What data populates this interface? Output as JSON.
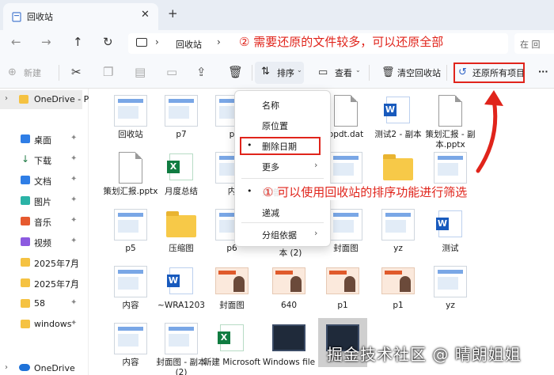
{
  "window": {
    "tab_title": "回收站",
    "close_glyph": "✕",
    "new_tab_glyph": "+"
  },
  "nav": {
    "back_glyph": "←",
    "forward_glyph": "→",
    "up_glyph": "↑",
    "refresh_glyph": "↻",
    "chevron": "›"
  },
  "address": {
    "location": "回收站",
    "search_placeholder": "在 回"
  },
  "toolbar": {
    "new_label": "新建",
    "sort_label": "排序",
    "view_label": "查看",
    "empty_bin_label": "清空回收站",
    "restore_all_label": "还原所有项目",
    "more_glyph": "···"
  },
  "sidebar": {
    "onedrive_top": "OneDrive - P",
    "items": [
      {
        "label": "桌面",
        "icon": "desktop-icon",
        "pinned": true
      },
      {
        "label": "下载",
        "icon": "download-icon",
        "pinned": true
      },
      {
        "label": "文档",
        "icon": "documents-icon",
        "pinned": true
      },
      {
        "label": "图片",
        "icon": "pictures-icon",
        "pinned": true
      },
      {
        "label": "音乐",
        "icon": "music-icon",
        "pinned": true
      },
      {
        "label": "视频",
        "icon": "videos-icon",
        "pinned": true
      },
      {
        "label": "2025年7月",
        "icon": "folder-icon",
        "pinned": true
      },
      {
        "label": "2025年7月",
        "icon": "folder-icon",
        "pinned": true
      },
      {
        "label": "58",
        "icon": "folder-icon",
        "pinned": true
      },
      {
        "label": "windows",
        "icon": "folder-icon",
        "pinned": true
      }
    ],
    "onedrive_bottom": "OneDrive",
    "pin_glyph": "📌"
  },
  "files": [
    {
      "name": "回收站",
      "kind": "thumb"
    },
    {
      "name": "p7",
      "kind": "thumb"
    },
    {
      "name": "opdt.dat",
      "kind": "doc"
    },
    {
      "name": "测试2 - 副本",
      "kind": "word"
    },
    {
      "name": "策划汇报 - 副本.pptx",
      "kind": "doc"
    },
    {
      "name": "策划汇报.pptx",
      "kind": "doc"
    },
    {
      "name": "月度总结",
      "kind": "excel"
    },
    {
      "name": "p5",
      "kind": "thumb"
    },
    {
      "name": "压缩图",
      "kind": "folder"
    },
    {
      "name": "封面图",
      "kind": "thumb"
    },
    {
      "name": "yz",
      "kind": "thumb"
    },
    {
      "name": "测试",
      "kind": "word"
    },
    {
      "name": "内容",
      "kind": "thumb"
    },
    {
      "name": "~WRA1203",
      "kind": "word"
    },
    {
      "name": "封面图",
      "kind": "avatar"
    },
    {
      "name": "640",
      "kind": "avatar"
    },
    {
      "name": "p1",
      "kind": "avatar"
    },
    {
      "name": "p1",
      "kind": "avatar"
    },
    {
      "name": "yz",
      "kind": "thumb"
    },
    {
      "name": "内容",
      "kind": "thumb"
    },
    {
      "name": "封面图 - 副本 (2)",
      "kind": "thumb"
    },
    {
      "name": "新建 Microsoft",
      "kind": "excel"
    },
    {
      "name": "Windows file",
      "kind": "screen"
    }
  ],
  "partial_labels": {
    "p_label_row1": "p",
    "p6": "p6",
    "nei": "内",
    "fengmian_copy2": "本 (2)"
  },
  "sort_menu": {
    "items": [
      {
        "label": "名称",
        "selected": false,
        "submenu": false
      },
      {
        "label": "原位置",
        "selected": false,
        "submenu": false
      },
      {
        "label": "删除日期",
        "selected": true,
        "submenu": false
      },
      {
        "label": "更多",
        "selected": false,
        "submenu": true
      },
      {
        "label": "递增",
        "selected": true,
        "submenu": false
      },
      {
        "label": "递减",
        "selected": false,
        "submenu": false
      },
      {
        "label": "分组依据",
        "selected": false,
        "submenu": true
      }
    ],
    "dot_glyph": "•",
    "submenu_glyph": "›"
  },
  "annotations": {
    "top_note": "② 需要还原的文件较多，可以还原全部",
    "middle_note": "① 可以使用回收站的排序功能进行筛选",
    "watermark": "掘金技术社区 @ 晴朗姐姐",
    "accent_color": "#e0241b"
  }
}
